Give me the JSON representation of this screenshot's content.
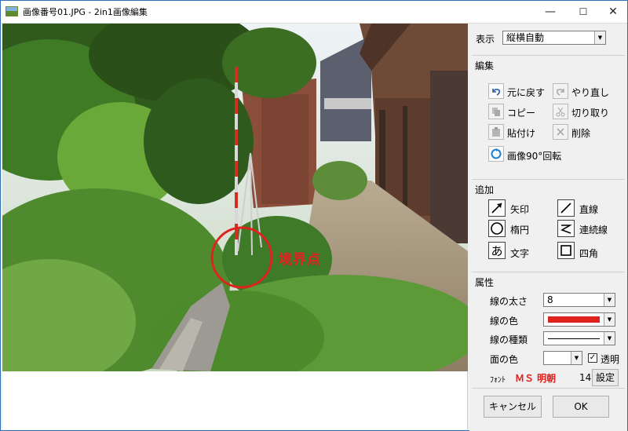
{
  "window": {
    "title": "画像番号01.JPG - 2in1画像編集",
    "minimize": "—",
    "maximize": "☐",
    "close": "✕"
  },
  "photo": {
    "annotation_label": "境界点",
    "annotation_color": "#e0221f"
  },
  "display": {
    "label": "表示",
    "value": "縦横自動"
  },
  "edit": {
    "title": "編集",
    "undo": "元に戻す",
    "redo": "やり直し",
    "copy": "コピー",
    "cut": "切り取り",
    "paste": "貼付け",
    "delete": "削除",
    "rotate": "画像90°回転"
  },
  "add": {
    "title": "追加",
    "arrow": "矢印",
    "line": "直線",
    "ellipse": "楕円",
    "polyline": "連続線",
    "text": "文字",
    "rect": "四角",
    "text_glyph": "あ"
  },
  "props": {
    "title": "属性",
    "line_width_label": "線の太さ",
    "line_width_value": "8",
    "line_color_label": "線の色",
    "line_color": "#e0221f",
    "line_type_label": "線の種類",
    "fill_color_label": "面の色",
    "transparent_label": "透明",
    "transparent_checked": "✓",
    "font_label": "ﾌｫﾝﾄ",
    "font_name": "ＭＳ 明朝",
    "font_size": "14",
    "font_set": "設定"
  },
  "footer": {
    "cancel": "キャンセル",
    "ok": "OK"
  }
}
